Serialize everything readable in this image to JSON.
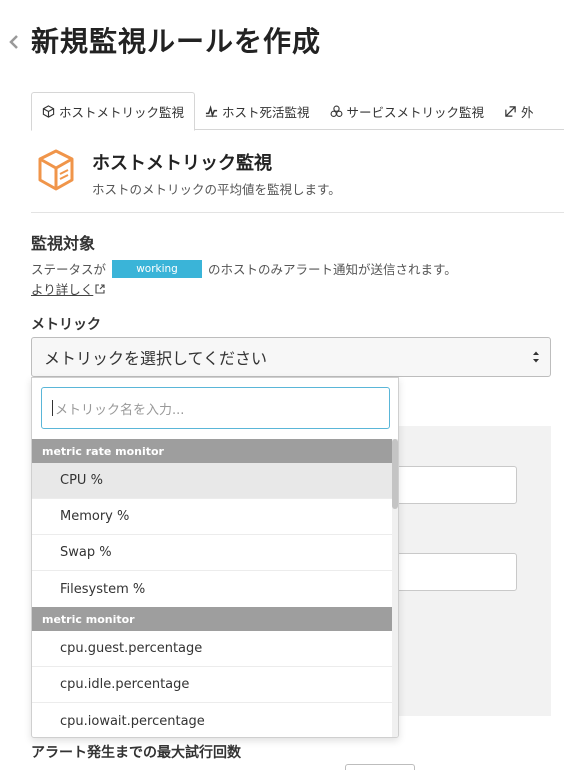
{
  "page": {
    "title": "新規監視ルールを作成"
  },
  "tabs": [
    {
      "label": "ホストメトリック監視",
      "icon": "cube-icon",
      "active": true
    },
    {
      "label": "ホスト死活監視",
      "icon": "heartbeat-icon"
    },
    {
      "label": "サービスメトリック監視",
      "icon": "cubes-icon"
    },
    {
      "label": "外",
      "icon": "external-check-icon"
    }
  ],
  "monitor_type": {
    "title": "ホストメトリック監視",
    "description": "ホストのメトリックの平均値を監視します。",
    "icon_color": "#f0954a"
  },
  "target": {
    "heading": "監視対象",
    "status_prefix": "ステータスが",
    "status_badge": "working",
    "status_suffix": "のホストのみアラート通知が送信されます。",
    "more_link": "より詳しく"
  },
  "metric": {
    "label": "メトリック",
    "select_value": "メトリックを選択してください",
    "search_placeholder": "メトリック名を入力...",
    "groups": [
      {
        "name": "metric rate monitor",
        "items": [
          "CPU %",
          "Memory %",
          "Swap %",
          "Filesystem %"
        ]
      },
      {
        "name": "metric monitor",
        "items": [
          "cpu.guest.percentage",
          "cpu.idle.percentage",
          "cpu.iowait.percentage"
        ]
      }
    ]
  },
  "retry": {
    "label": "アラート発生までの最大試行回数"
  },
  "colors": {
    "accent": "#3ab4d8",
    "group_header": "#9e9e9e"
  }
}
